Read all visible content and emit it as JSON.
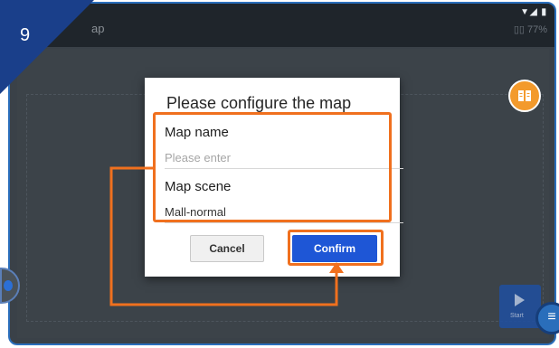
{
  "step_number": "9",
  "topbar": {
    "title": "ap"
  },
  "status": {
    "icons": "▼◢ ▮",
    "battery_text": "▯▯ 77%"
  },
  "dialog": {
    "title": "Please configure the map",
    "map_name": {
      "label": "Map name",
      "placeholder": "Please enter",
      "value": ""
    },
    "map_scene": {
      "label": "Map scene",
      "value": "Mall-normal"
    },
    "cancel_label": "Cancel",
    "confirm_label": "Confirm"
  },
  "start_label": "Start",
  "colors": {
    "highlight": "#f0701e",
    "confirm": "#1e56d6",
    "frame": "#2a6ebb",
    "guide": "#f39a2c"
  }
}
